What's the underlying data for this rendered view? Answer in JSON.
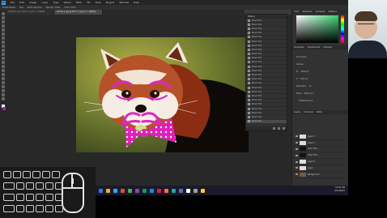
{
  "app": {
    "logo_text": "Ps",
    "menu": [
      "File",
      "Edit",
      "Image",
      "Layer",
      "Type",
      "Select",
      "Filter",
      "3D",
      "View",
      "Plugins",
      "Window",
      "Help"
    ],
    "options": [
      "Brush Preset",
      "Size",
      "Mode: Normal",
      "Opacity: 100%",
      "Flow: 100%"
    ],
    "tabs": [
      {
        "label": "Untitled-1 @ 100% (Layer 1, RGB/8)",
        "active": false
      },
      {
        "label": "panda-1.jpg @ 66.7% (Layer 1, RGB/8)",
        "active": true
      }
    ],
    "status": "66.67%"
  },
  "history": {
    "title": "History",
    "items": [
      "Brush Tool",
      "Brush Tool",
      "Brush Tool",
      "Brush Tool",
      "Brush Tool",
      "Brush Tool",
      "Brush Tool",
      "Brush Tool",
      "Brush Tool",
      "Brush Tool",
      "Brush Tool",
      "Brush Tool",
      "Brush Tool",
      "Brush Tool",
      "Brush Tool",
      "Brush Tool",
      "Brush Tool",
      "Brush Tool",
      "Brush Tool",
      "Brush Tool",
      "Brush Tool",
      "Brush Tool",
      "Brush Tool",
      "Brush Tool",
      "Brush Tool"
    ],
    "current_index": 24
  },
  "color_panel": {
    "tabs": [
      "Color",
      "Swatches",
      "Gradients",
      "Patterns"
    ],
    "foreground": "#ffffff",
    "background": "#b01f9a",
    "hue": "#3ad175"
  },
  "properties": {
    "tabs": [
      "Properties",
      "Adjustments",
      "Libraries"
    ],
    "rows": [
      {
        "label": "Document",
        "value": ""
      },
      {
        "label": "Canvas",
        "value": ""
      },
      {
        "label": "W",
        "value": "1600 px"
      },
      {
        "label": "H",
        "value": "1067 px"
      },
      {
        "label": "Resolution",
        "value": "72"
      },
      {
        "label": "Mode",
        "value": "RGB Color"
      },
      {
        "label": "",
        "value": "8 Bits/Channel"
      }
    ]
  },
  "layers": {
    "tabs": [
      "Layers",
      "Channels",
      "Paths"
    ],
    "items": [
      {
        "name": "Layer 2",
        "thumb": "light"
      },
      {
        "name": "Layer 1",
        "thumb": "light"
      },
      {
        "name": "Color Fill 1",
        "thumb": "dark"
      },
      {
        "name": "Color Fill 2",
        "thumb": "dark"
      },
      {
        "name": "Layer 0",
        "thumb": "light"
      },
      {
        "name": "Layer",
        "thumb": "light"
      },
      {
        "name": "Background",
        "thumb": "photo"
      }
    ]
  },
  "taskbar": {
    "time": "10:42 AM",
    "date": "3/21/2022"
  },
  "keyboard_overlay": {
    "rows": 4
  }
}
